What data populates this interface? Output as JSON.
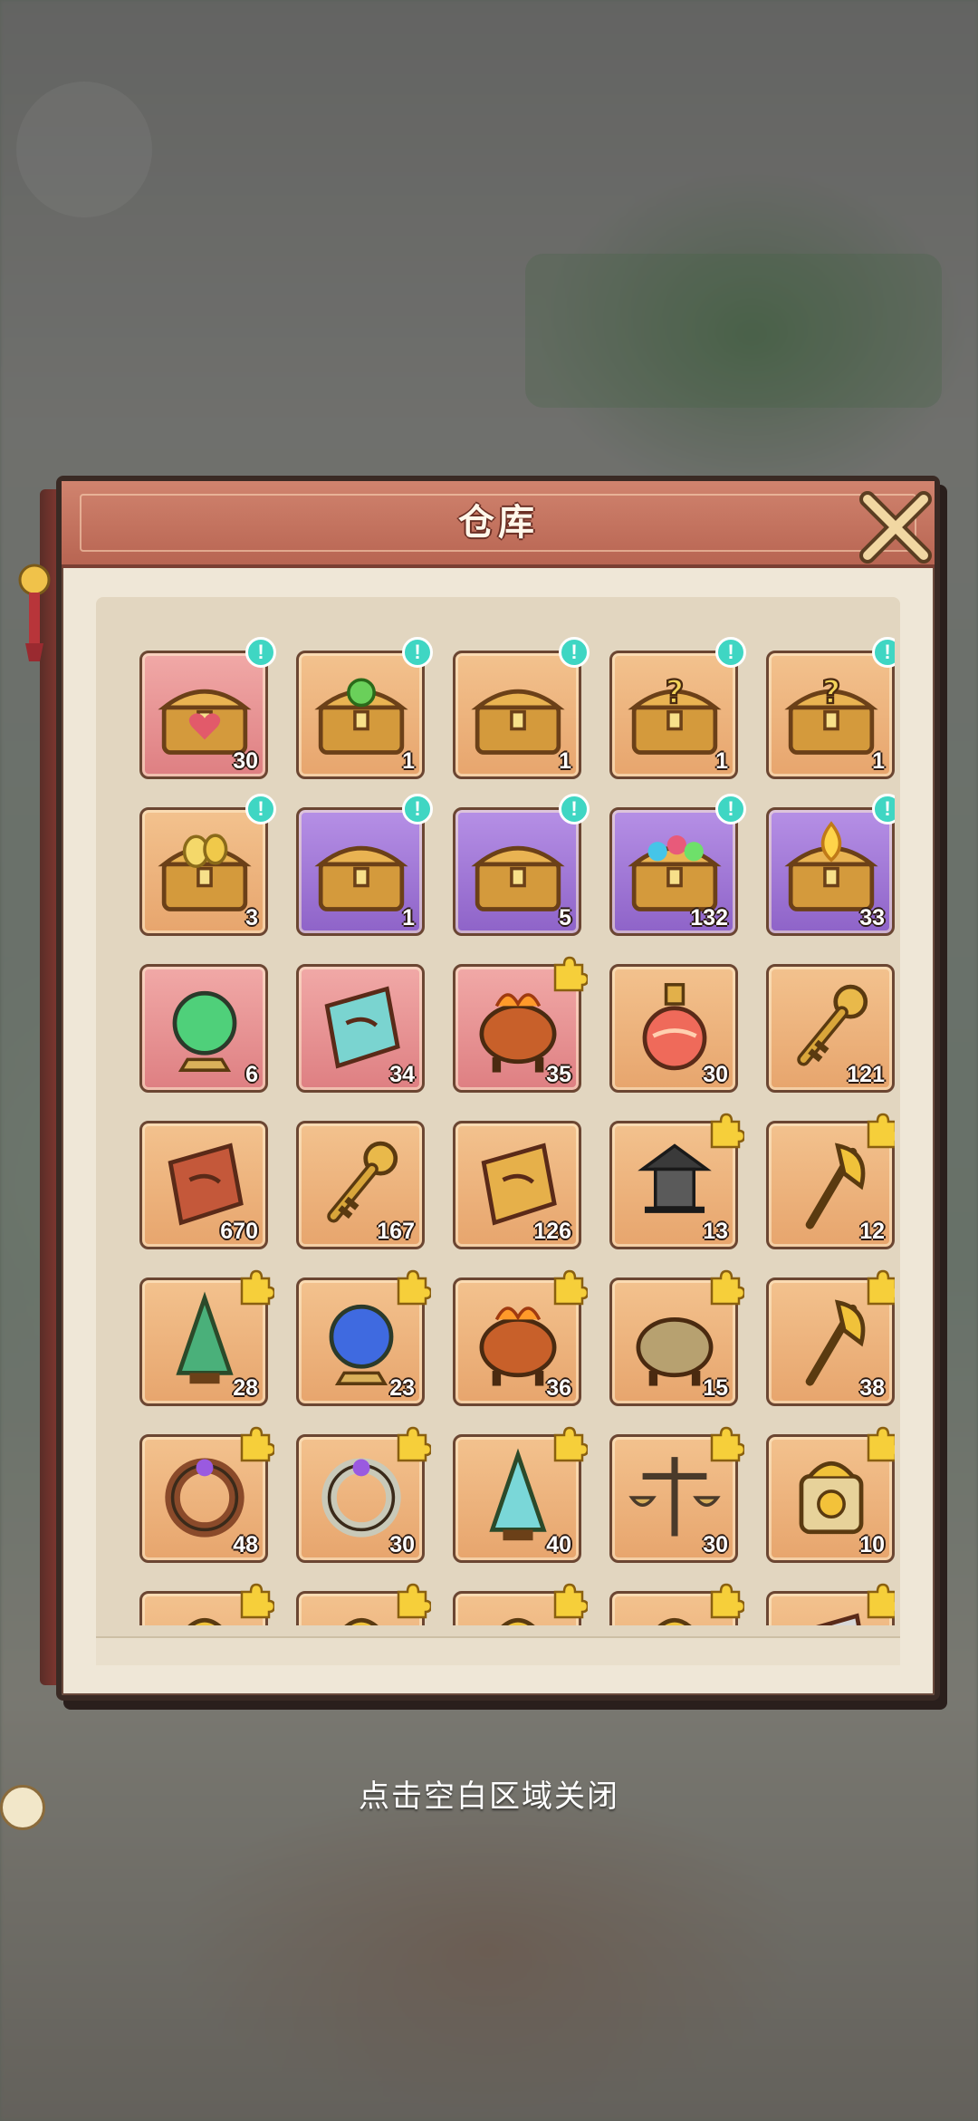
{
  "window": {
    "title": "仓库"
  },
  "hint_text": "点击空白区域关闭",
  "colors": {
    "orange_cell": "#e7a56d",
    "pink_cell": "#de7f82",
    "purple_cell": "#8e63c8",
    "info_badge": "#3fd6c3",
    "header": "#b86552"
  },
  "items": [
    {
      "icon": "heart-chest-icon",
      "bg": "pink",
      "count": "30",
      "badge": "info"
    },
    {
      "icon": "dragon-chest-icon",
      "bg": "orange",
      "count": "1",
      "badge": "info"
    },
    {
      "icon": "puzzle-chest-icon",
      "bg": "orange",
      "count": "1",
      "badge": "info"
    },
    {
      "icon": "mystery-chest-icon",
      "bg": "orange",
      "count": "1",
      "badge": "info"
    },
    {
      "icon": "mystery-chest-icon",
      "bg": "orange",
      "count": "1",
      "badge": "info"
    },
    {
      "icon": "egg-chest-icon",
      "bg": "orange",
      "count": "3",
      "badge": "info"
    },
    {
      "icon": "scroll-chest-icon",
      "bg": "purple",
      "count": "1",
      "badge": "info"
    },
    {
      "icon": "puzzle-chest-icon",
      "bg": "purple",
      "count": "5",
      "badge": "info"
    },
    {
      "icon": "gem-chest-icon",
      "bg": "purple",
      "count": "132",
      "badge": "info"
    },
    {
      "icon": "flame-chest-icon",
      "bg": "purple",
      "count": "33",
      "badge": "info"
    },
    {
      "icon": "green-orb-icon",
      "bg": "pink",
      "count": "6",
      "badge": ""
    },
    {
      "icon": "magic-carpet-icon",
      "bg": "pink",
      "count": "34",
      "badge": ""
    },
    {
      "icon": "flame-cauldron-icon",
      "bg": "pink",
      "count": "35",
      "badge": "puzzle"
    },
    {
      "icon": "potion-icon",
      "bg": "orange",
      "count": "30",
      "badge": ""
    },
    {
      "icon": "golden-key-icon",
      "bg": "orange",
      "count": "121",
      "badge": ""
    },
    {
      "icon": "copper-scroll-icon",
      "bg": "orange",
      "count": "670",
      "badge": ""
    },
    {
      "icon": "bronze-key-icon",
      "bg": "orange",
      "count": "167",
      "badge": ""
    },
    {
      "icon": "golden-scroll-icon",
      "bg": "orange",
      "count": "126",
      "badge": ""
    },
    {
      "icon": "pagoda-lantern-icon",
      "bg": "orange",
      "count": "13",
      "badge": "puzzle"
    },
    {
      "icon": "golden-axe-icon",
      "bg": "orange",
      "count": "12",
      "badge": "puzzle"
    },
    {
      "icon": "jade-bell-icon",
      "bg": "orange",
      "count": "28",
      "badge": "puzzle"
    },
    {
      "icon": "blue-mirror-icon",
      "bg": "orange",
      "count": "23",
      "badge": "puzzle"
    },
    {
      "icon": "flame-wheel-icon",
      "bg": "orange",
      "count": "36",
      "badge": "puzzle"
    },
    {
      "icon": "bronze-cauldron-icon",
      "bg": "orange",
      "count": "15",
      "badge": "puzzle"
    },
    {
      "icon": "crossbow-icon",
      "bg": "orange",
      "count": "38",
      "badge": "puzzle"
    },
    {
      "icon": "amulet-icon",
      "bg": "orange",
      "count": "48",
      "badge": "puzzle"
    },
    {
      "icon": "jade-ring-icon",
      "bg": "orange",
      "count": "30",
      "badge": "puzzle"
    },
    {
      "icon": "coral-tree-icon",
      "bg": "orange",
      "count": "40",
      "badge": "puzzle"
    },
    {
      "icon": "balance-scale-icon",
      "bg": "orange",
      "count": "30",
      "badge": "puzzle"
    },
    {
      "icon": "dragon-seal-icon",
      "bg": "orange",
      "count": "10",
      "badge": "puzzle"
    },
    {
      "icon": "dragon-seal-icon",
      "bg": "orange",
      "count": "",
      "badge": "puzzle"
    },
    {
      "icon": "dragon-seal-icon",
      "bg": "orange",
      "count": "",
      "badge": "puzzle"
    },
    {
      "icon": "dragon-seal-icon",
      "bg": "orange",
      "count": "",
      "badge": "puzzle"
    },
    {
      "icon": "dragon-seal-icon",
      "bg": "orange",
      "count": "",
      "badge": "puzzle"
    },
    {
      "icon": "silver-scroll-icon",
      "bg": "orange",
      "count": "",
      "badge": "puzzle"
    }
  ]
}
